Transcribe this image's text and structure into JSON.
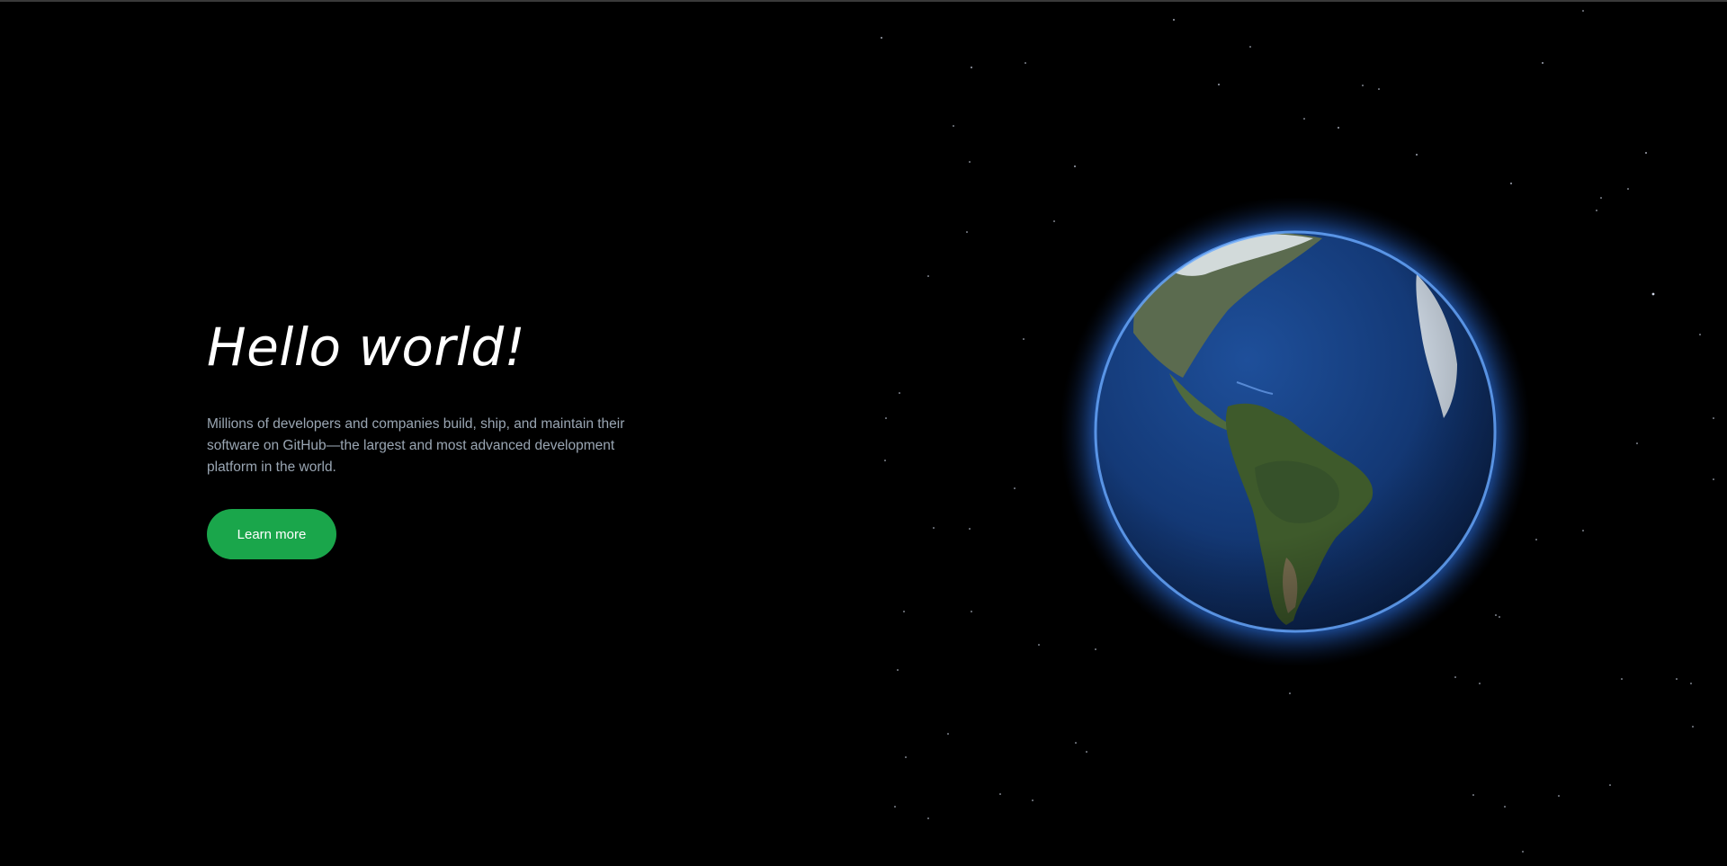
{
  "hero": {
    "title": "Hello world!",
    "description": "Millions of developers and companies build, ship, and maintain their software on GitHub—the largest and most advanced development platform in the world.",
    "button_label": "Learn more"
  },
  "colors": {
    "background": "#000000",
    "button": "#1aa64b",
    "text_muted": "#9aa6b3",
    "globe_glow": "#3b8bff"
  },
  "icons": {
    "globe": "earth-globe-icon"
  }
}
